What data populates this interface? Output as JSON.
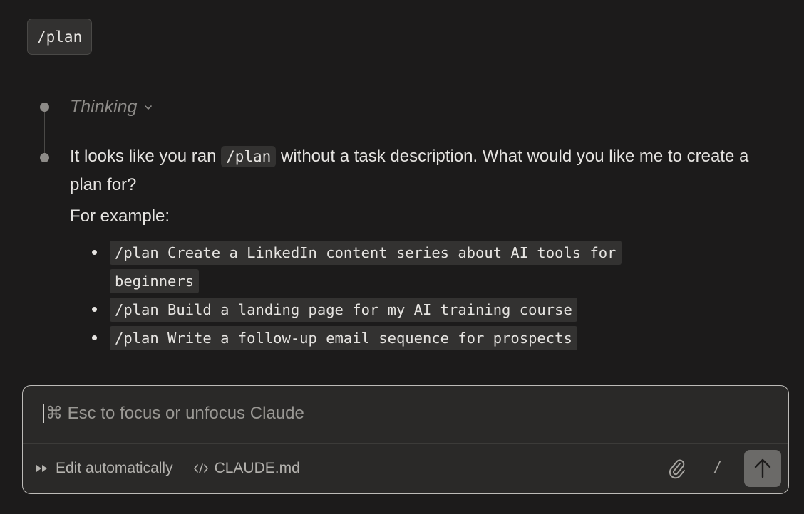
{
  "user_message": {
    "text": "/plan"
  },
  "thinking": {
    "label": "Thinking"
  },
  "response": {
    "text_before": "It looks like you ran ",
    "inline_code": "/plan",
    "text_after": " without a task description. What would you like me to create a plan for?",
    "example_label": "For example:",
    "examples": [
      "/plan Create a LinkedIn content series about AI tools for beginners",
      "/plan Build a landing page for my AI training course",
      "/plan Write a follow-up email sequence for prospects"
    ]
  },
  "composer": {
    "placeholder": "⌘ Esc to focus or unfocus Claude",
    "edit_mode_label": "Edit automatically",
    "file_label": "CLAUDE.md",
    "slash_label": "/"
  },
  "icons": {
    "edit_mode": "fast-forward-icon",
    "file": "code-icon",
    "attach": "paperclip-icon",
    "send": "arrow-up-icon",
    "thinking_toggle": "chevron-down-icon"
  }
}
